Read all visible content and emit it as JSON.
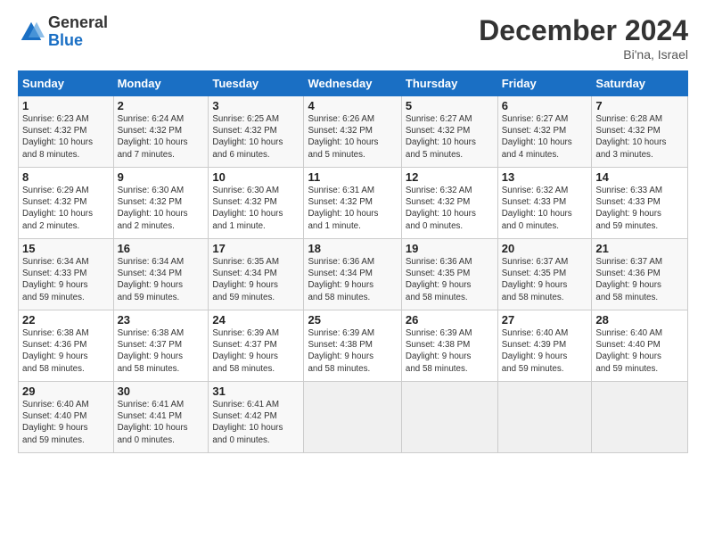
{
  "logo": {
    "general": "General",
    "blue": "Blue"
  },
  "header": {
    "title": "December 2024",
    "subtitle": "Bi'na, Israel"
  },
  "columns": [
    "Sunday",
    "Monday",
    "Tuesday",
    "Wednesday",
    "Thursday",
    "Friday",
    "Saturday"
  ],
  "weeks": [
    [
      {
        "day": "1",
        "info": "Sunrise: 6:23 AM\nSunset: 4:32 PM\nDaylight: 10 hours\nand 8 minutes."
      },
      {
        "day": "2",
        "info": "Sunrise: 6:24 AM\nSunset: 4:32 PM\nDaylight: 10 hours\nand 7 minutes."
      },
      {
        "day": "3",
        "info": "Sunrise: 6:25 AM\nSunset: 4:32 PM\nDaylight: 10 hours\nand 6 minutes."
      },
      {
        "day": "4",
        "info": "Sunrise: 6:26 AM\nSunset: 4:32 PM\nDaylight: 10 hours\nand 5 minutes."
      },
      {
        "day": "5",
        "info": "Sunrise: 6:27 AM\nSunset: 4:32 PM\nDaylight: 10 hours\nand 5 minutes."
      },
      {
        "day": "6",
        "info": "Sunrise: 6:27 AM\nSunset: 4:32 PM\nDaylight: 10 hours\nand 4 minutes."
      },
      {
        "day": "7",
        "info": "Sunrise: 6:28 AM\nSunset: 4:32 PM\nDaylight: 10 hours\nand 3 minutes."
      }
    ],
    [
      {
        "day": "8",
        "info": "Sunrise: 6:29 AM\nSunset: 4:32 PM\nDaylight: 10 hours\nand 2 minutes."
      },
      {
        "day": "9",
        "info": "Sunrise: 6:30 AM\nSunset: 4:32 PM\nDaylight: 10 hours\nand 2 minutes."
      },
      {
        "day": "10",
        "info": "Sunrise: 6:30 AM\nSunset: 4:32 PM\nDaylight: 10 hours\nand 1 minute."
      },
      {
        "day": "11",
        "info": "Sunrise: 6:31 AM\nSunset: 4:32 PM\nDaylight: 10 hours\nand 1 minute."
      },
      {
        "day": "12",
        "info": "Sunrise: 6:32 AM\nSunset: 4:32 PM\nDaylight: 10 hours\nand 0 minutes."
      },
      {
        "day": "13",
        "info": "Sunrise: 6:32 AM\nSunset: 4:33 PM\nDaylight: 10 hours\nand 0 minutes."
      },
      {
        "day": "14",
        "info": "Sunrise: 6:33 AM\nSunset: 4:33 PM\nDaylight: 9 hours\nand 59 minutes."
      }
    ],
    [
      {
        "day": "15",
        "info": "Sunrise: 6:34 AM\nSunset: 4:33 PM\nDaylight: 9 hours\nand 59 minutes."
      },
      {
        "day": "16",
        "info": "Sunrise: 6:34 AM\nSunset: 4:34 PM\nDaylight: 9 hours\nand 59 minutes."
      },
      {
        "day": "17",
        "info": "Sunrise: 6:35 AM\nSunset: 4:34 PM\nDaylight: 9 hours\nand 59 minutes."
      },
      {
        "day": "18",
        "info": "Sunrise: 6:36 AM\nSunset: 4:34 PM\nDaylight: 9 hours\nand 58 minutes."
      },
      {
        "day": "19",
        "info": "Sunrise: 6:36 AM\nSunset: 4:35 PM\nDaylight: 9 hours\nand 58 minutes."
      },
      {
        "day": "20",
        "info": "Sunrise: 6:37 AM\nSunset: 4:35 PM\nDaylight: 9 hours\nand 58 minutes."
      },
      {
        "day": "21",
        "info": "Sunrise: 6:37 AM\nSunset: 4:36 PM\nDaylight: 9 hours\nand 58 minutes."
      }
    ],
    [
      {
        "day": "22",
        "info": "Sunrise: 6:38 AM\nSunset: 4:36 PM\nDaylight: 9 hours\nand 58 minutes."
      },
      {
        "day": "23",
        "info": "Sunrise: 6:38 AM\nSunset: 4:37 PM\nDaylight: 9 hours\nand 58 minutes."
      },
      {
        "day": "24",
        "info": "Sunrise: 6:39 AM\nSunset: 4:37 PM\nDaylight: 9 hours\nand 58 minutes."
      },
      {
        "day": "25",
        "info": "Sunrise: 6:39 AM\nSunset: 4:38 PM\nDaylight: 9 hours\nand 58 minutes."
      },
      {
        "day": "26",
        "info": "Sunrise: 6:39 AM\nSunset: 4:38 PM\nDaylight: 9 hours\nand 58 minutes."
      },
      {
        "day": "27",
        "info": "Sunrise: 6:40 AM\nSunset: 4:39 PM\nDaylight: 9 hours\nand 59 minutes."
      },
      {
        "day": "28",
        "info": "Sunrise: 6:40 AM\nSunset: 4:40 PM\nDaylight: 9 hours\nand 59 minutes."
      }
    ],
    [
      {
        "day": "29",
        "info": "Sunrise: 6:40 AM\nSunset: 4:40 PM\nDaylight: 9 hours\nand 59 minutes."
      },
      {
        "day": "30",
        "info": "Sunrise: 6:41 AM\nSunset: 4:41 PM\nDaylight: 10 hours\nand 0 minutes."
      },
      {
        "day": "31",
        "info": "Sunrise: 6:41 AM\nSunset: 4:42 PM\nDaylight: 10 hours\nand 0 minutes."
      },
      null,
      null,
      null,
      null
    ]
  ]
}
